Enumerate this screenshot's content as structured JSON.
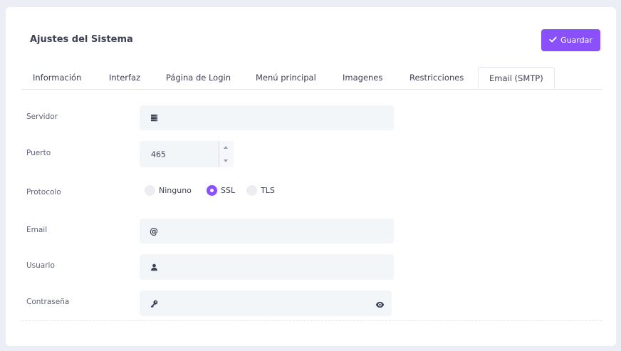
{
  "page": {
    "title": "Ajustes del Sistema",
    "save_label": "Guardar"
  },
  "tabs": [
    {
      "label": "Información"
    },
    {
      "label": "Interfaz"
    },
    {
      "label": "Página de Login"
    },
    {
      "label": "Menú principal"
    },
    {
      "label": "Imagenes"
    },
    {
      "label": "Restricciones"
    },
    {
      "label": "Email (SMTP)",
      "active": true
    }
  ],
  "form": {
    "server": {
      "label": "Servidor",
      "value": "",
      "icon": "server-icon"
    },
    "port": {
      "label": "Puerto",
      "value": "465"
    },
    "protocol": {
      "label": "Protocolo",
      "options": [
        {
          "label": "Ninguno",
          "checked": false
        },
        {
          "label": "SSL",
          "checked": true
        },
        {
          "label": "TLS",
          "checked": false
        }
      ]
    },
    "email": {
      "label": "Email",
      "value": "",
      "icon": "at-icon"
    },
    "username": {
      "label": "Usuario",
      "value": "",
      "icon": "user-icon"
    },
    "password": {
      "label": "Contraseña",
      "value": "",
      "icon": "key-icon",
      "toggle_icon": "eye-icon"
    }
  },
  "colors": {
    "accent": "#8950fc",
    "field_bg": "#f3f6f9",
    "page_bg": "#eceef5"
  }
}
